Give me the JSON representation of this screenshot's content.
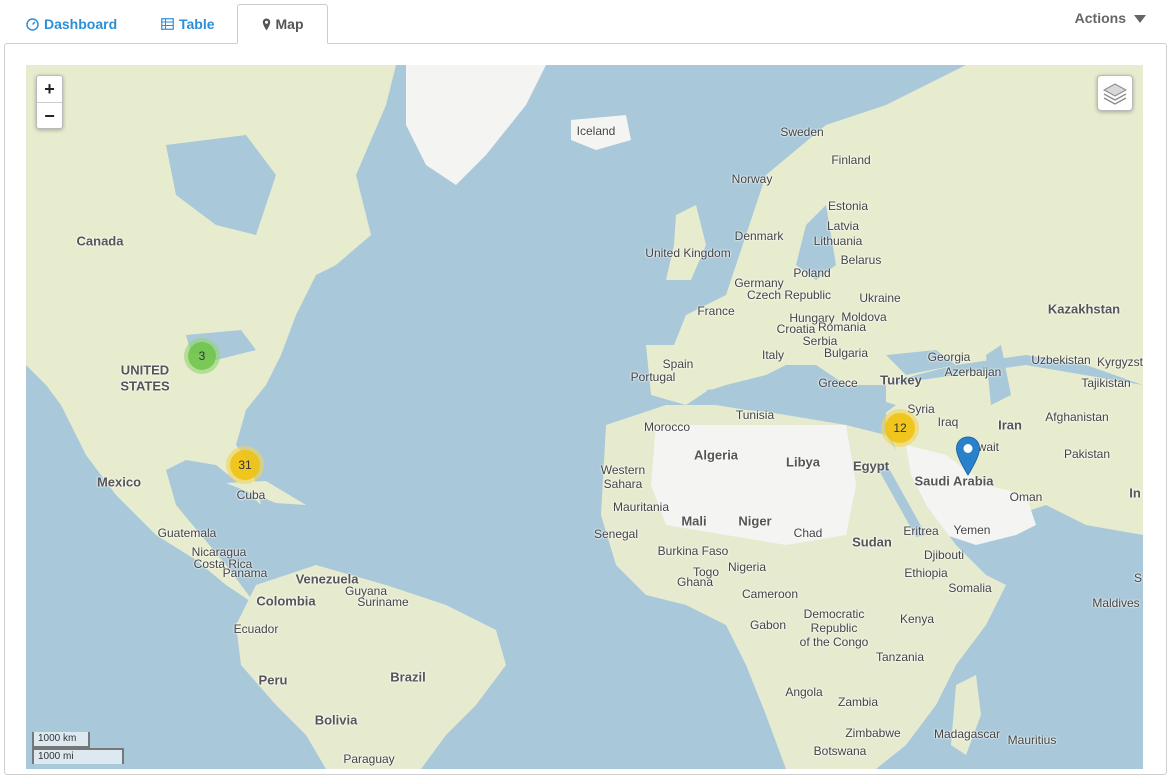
{
  "tabs": [
    {
      "id": "dashboard",
      "label": "Dashboard",
      "icon": "dashboard-icon",
      "active": false
    },
    {
      "id": "table",
      "label": "Table",
      "icon": "table-icon",
      "active": false
    },
    {
      "id": "map",
      "label": "Map",
      "icon": "map-pin-icon",
      "active": true
    }
  ],
  "actions": {
    "label": "Actions"
  },
  "map": {
    "zoom_in": "+",
    "zoom_out": "−",
    "scale_km": "1000 km",
    "scale_mi": "1000 mi",
    "clusters": [
      {
        "count": "3",
        "color": "#70c44a",
        "region": "United States (Midwest)"
      },
      {
        "count": "31",
        "color": "#f0c20c",
        "region": "Florida"
      },
      {
        "count": "12",
        "color": "#f0c20c",
        "region": "Eastern Mediterranean"
      }
    ],
    "marker": {
      "color": "#2a81cb",
      "region": "Persian Gulf"
    },
    "labels": {
      "canada": "Canada",
      "united_states": "UNITED",
      "united_states_2": "STATES",
      "mexico": "Mexico",
      "cuba": "Cuba",
      "guatemala": "Guatemala",
      "nicaragua": "Nicaragua",
      "costa_rica": "Costa Rica",
      "panama": "Panama",
      "venezuela": "Venezuela",
      "guyana": "Guyana",
      "suriname": "Suriname",
      "colombia": "Colombia",
      "ecuador": "Ecuador",
      "peru": "Peru",
      "brazil": "Brazil",
      "bolivia": "Bolivia",
      "paraguay": "Paraguay",
      "iceland": "Iceland",
      "sweden": "Sweden",
      "finland": "Finland",
      "norway": "Norway",
      "estonia": "Estonia",
      "latvia": "Latvia",
      "lithuania": "Lithuania",
      "denmark": "Denmark",
      "united_kingdom": "United Kingdom",
      "belarus": "Belarus",
      "poland": "Poland",
      "germany": "Germany",
      "czech": "Czech Republic",
      "ukraine": "Ukraine",
      "france": "France",
      "hungary": "Hungary",
      "moldova": "Moldova",
      "croatia": "Croatia",
      "romania": "Romania",
      "serbia": "Serbia",
      "bulgaria": "Bulgaria",
      "italy": "Italy",
      "spain": "Spain",
      "portugal": "Portugal",
      "greece": "Greece",
      "turkey": "Turkey",
      "georgia": "Georgia",
      "azerbaijan": "Azerbaijan",
      "kazakhstan": "Kazakhstan",
      "uzbekistan": "Uzbekistan",
      "kyrgyzstan": "Kyrgyzst",
      "tajikistan": "Tajikistan",
      "afghanistan": "Afghanistan",
      "pakistan": "Pakistan",
      "iran": "Iran",
      "iraq": "Iraq",
      "syria": "Syria",
      "kuwait": "Kuwait",
      "saudi": "Saudi Arabia",
      "oman": "Oman",
      "yemen": "Yemen",
      "india_partial": "In",
      "tunisia": "Tunisia",
      "morocco": "Morocco",
      "algeria": "Algeria",
      "libya": "Libya",
      "egypt": "Egypt",
      "western_sahara": "Western",
      "western_sahara_2": "Sahara",
      "mauritania": "Mauritania",
      "mali": "Mali",
      "niger": "Niger",
      "chad": "Chad",
      "sudan": "Sudan",
      "eritrea": "Eritrea",
      "djibouti": "Djibouti",
      "ethiopia": "Ethiopia",
      "somalia": "Somalia",
      "senegal": "Senegal",
      "burkina": "Burkina Faso",
      "nigeria": "Nigeria",
      "togo": "Togo",
      "ghana": "Ghana",
      "cameroon": "Cameroon",
      "gabon": "Gabon",
      "drc": "Democratic",
      "drc_2": "Republic",
      "drc_3": "of the Congo",
      "kenya": "Kenya",
      "tanzania": "Tanzania",
      "angola": "Angola",
      "zambia": "Zambia",
      "zimbabwe": "Zimbabwe",
      "botswana": "Botswana",
      "madagascar": "Madagascar",
      "mauritius": "Mauritius",
      "maldives": "Maldives",
      "s_partial": "S"
    }
  }
}
